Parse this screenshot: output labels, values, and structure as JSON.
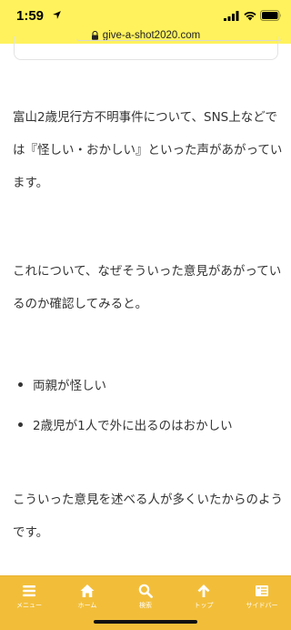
{
  "status_bar": {
    "time": "1:59",
    "url": "give-a-shot2020.com"
  },
  "article": {
    "paragraph1": [
      "富山2歳児行方不明事件について、SNS上などで",
      "は『怪しい・おかしい』といった声があがってい",
      "ます。"
    ],
    "paragraph2": [
      "これについて、なぜそういった意見があがってい",
      "るのか確認してみると。"
    ],
    "bullets": [
      "両親が怪しい",
      "2歳児が1人で外に出るのはおかしい"
    ],
    "paragraph3": [
      "こういった意見を述べる人が多くいたからのよう",
      "です。"
    ]
  },
  "bottom_nav": {
    "items": [
      {
        "label": "メニュー",
        "icon": "menu-icon"
      },
      {
        "label": "ホーム",
        "icon": "home-icon"
      },
      {
        "label": "検索",
        "icon": "search-icon"
      },
      {
        "label": "トップ",
        "icon": "arrow-up-icon"
      },
      {
        "label": "サイドバー",
        "icon": "sidebar-icon"
      }
    ]
  },
  "colors": {
    "status_bar_bg": "#fff25c",
    "bottom_nav_bg": "#f2be3a",
    "text": "#333333"
  }
}
